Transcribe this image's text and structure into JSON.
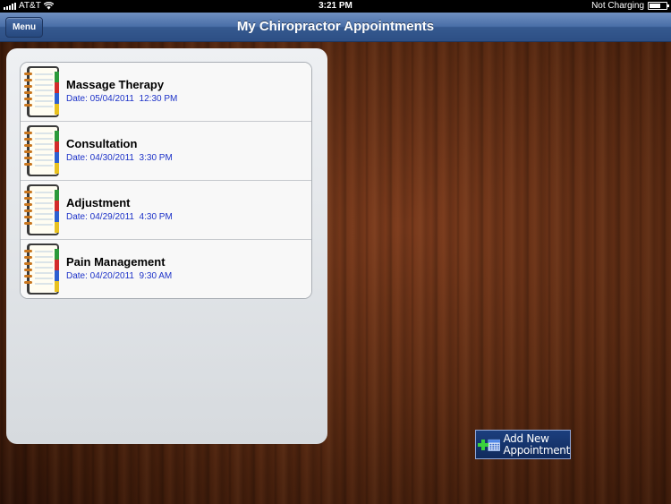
{
  "status_bar": {
    "carrier": "AT&T",
    "time": "3:21 PM",
    "charging": "Not Charging"
  },
  "nav": {
    "menu_label": "Menu",
    "title": "My Chiropractor Appointments"
  },
  "appointments": [
    {
      "title": "Massage Therapy",
      "date": "Date: 05/04/2011  12:30 PM"
    },
    {
      "title": "Consultation",
      "date": "Date: 04/30/2011  3:30 PM"
    },
    {
      "title": "Adjustment",
      "date": "Date: 04/29/2011  4:30 PM"
    },
    {
      "title": "Pain Management",
      "date": "Date: 04/20/2011  9:30 AM"
    }
  ],
  "add_button": {
    "line1": "Add New",
    "line2": "Appointment"
  },
  "icons": {
    "row": "notebook-icon",
    "add": "calendar-add-icon"
  }
}
